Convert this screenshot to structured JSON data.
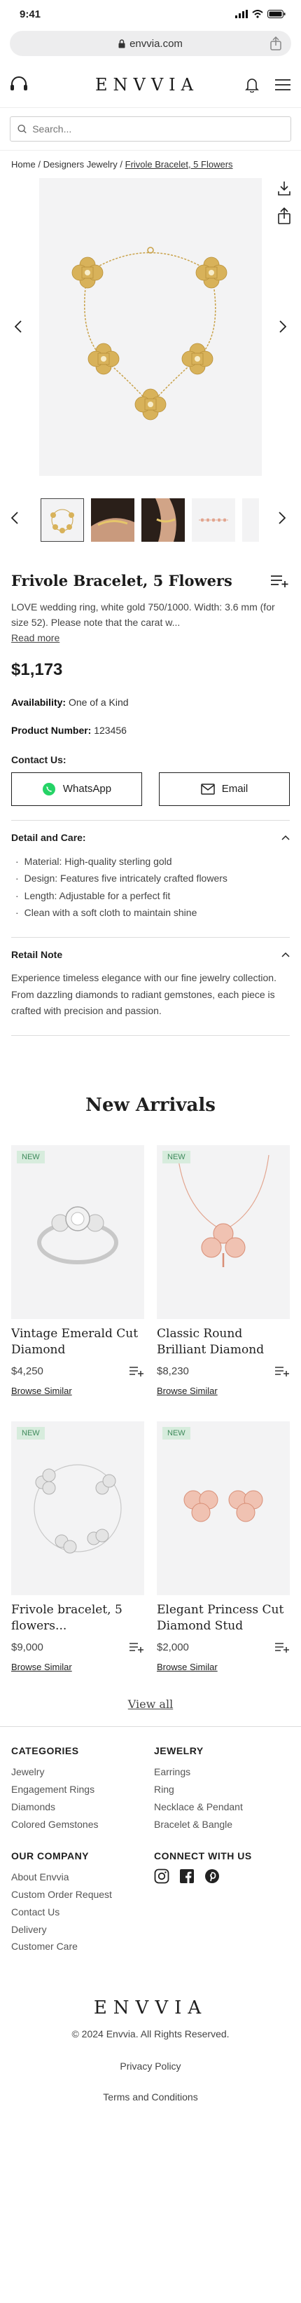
{
  "status_bar": {
    "time": "9:41"
  },
  "browser": {
    "url": "envvia.com"
  },
  "header": {
    "logo": "ENVVIA"
  },
  "search": {
    "placeholder": "Search..."
  },
  "breadcrumb": {
    "home": "Home",
    "category": "Designers Jewelry",
    "current": "Frivole Bracelet, 5 Flowers",
    "sep": "/"
  },
  "product": {
    "title": "Frivole Bracelet, 5 Flowers",
    "description": "LOVE wedding ring, white gold 750/1000. Width: 3.6 mm (for size 52). Please note that the carat w...",
    "read_more": "Read more",
    "price": "$1,173",
    "availability_label": "Availability:",
    "availability_value": "One of a Kind",
    "product_number_label": "Product Number:",
    "product_number_value": "123456",
    "contact_label": "Contact Us:",
    "whatsapp_label": "WhatsApp",
    "email_label": "Email"
  },
  "detail": {
    "heading": "Detail and Care:",
    "items": [
      "Material: High-quality sterling gold",
      "Design: Features five intricately crafted flowers",
      "Length: Adjustable for a perfect fit",
      "Clean with a soft cloth to maintain shine"
    ]
  },
  "retail": {
    "heading": "Retail Note",
    "text": "Experience timeless elegance with our fine jewelry collection. From dazzling diamonds to radiant gemstones, each piece is crafted with precision and passion."
  },
  "new_arrivals": {
    "title": "New Arrivals",
    "badge": "NEW",
    "browse_similar": "Browse Similar",
    "products": [
      {
        "name": "Vintage Emerald Cut Diamond Engagement...",
        "price": "$4,250"
      },
      {
        "name": "Classic Round Brilliant Diamond Solitaire Nec...",
        "price": "$8,230"
      },
      {
        "name": "Frivole bracelet, 5 flowers...",
        "price": "$9,000"
      },
      {
        "name": "Elegant Princess Cut Diamond Stud Earrings",
        "price": "$2,000"
      }
    ],
    "view_all": "View all"
  },
  "footer": {
    "categories": {
      "heading": "CATEGORIES",
      "links": [
        "Jewelry",
        "Engagement Rings",
        "Diamonds",
        "Colored Gemstones"
      ]
    },
    "jewelry": {
      "heading": "JEWELRY",
      "links": [
        "Earrings",
        "Ring",
        "Necklace & Pendant",
        "Bracelet & Bangle"
      ]
    },
    "company": {
      "heading": "OUR COMPANY",
      "links": [
        "About Envvia",
        "Custom Order Request",
        "Contact Us",
        "Delivery",
        "Customer Care"
      ]
    },
    "connect": {
      "heading": "CONNECT WITH US",
      "icons": [
        "instagram-icon",
        "facebook-icon",
        "pinterest-icon"
      ]
    },
    "logo": "ENVVIA",
    "copyright": "© 2024 Envvia. All Rights Reserved.",
    "privacy": "Privacy Policy",
    "terms": "Terms and Conditions"
  },
  "colors": {
    "gold": "#d8b25a",
    "rose_gold": "#e2a58f",
    "badge_bg": "#d7ecdd",
    "badge_text": "#3f8a5c",
    "whatsapp": "#25d366"
  }
}
